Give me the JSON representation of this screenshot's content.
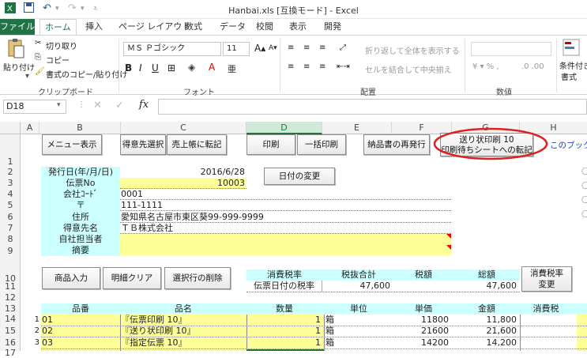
{
  "title_bar": {
    "title": "Hanbai.xls [互換モード] - Excel"
  },
  "tabs": [
    "ファイル",
    "ホーム",
    "挿入",
    "ページ レイアウト",
    "数式",
    "データ",
    "校閲",
    "表示",
    "開発"
  ],
  "ribbon": {
    "clipboard": {
      "paste": "貼り付け",
      "cut": "切り取り",
      "copy": "コピー",
      "format_painter": "書式のコピー/貼り付け",
      "group": "クリップボード"
    },
    "font": {
      "font_name": "ＭＳ Ｐゴシック",
      "font_size": "11",
      "group": "フォント"
    },
    "alignment": {
      "wrap": "折り返して全体を表示する",
      "merge": "セルを結合して中央揃え",
      "group": "配置"
    },
    "number": {
      "group": "数値"
    },
    "styles": {
      "cond": "条件付き",
      "fmt": "書式"
    }
  },
  "formula_bar": {
    "name_box": "D18",
    "fx": "fx"
  },
  "columns": [
    "A",
    "B",
    "C",
    "D",
    "E",
    "F",
    "G",
    "H"
  ],
  "rows": [
    "1",
    "2",
    "3",
    "4",
    "5",
    "6",
    "7",
    "8",
    "9",
    "10",
    "11",
    "12",
    "13",
    "14",
    "15",
    "16",
    "17"
  ],
  "buttons": {
    "menu": "メニュー表示",
    "client_select": "得意先選択",
    "to_ledger": "売上帳に転記",
    "print": "印刷",
    "batch_print": "一括印刷",
    "reissue": "納品書の再発行",
    "transfer_line1": "送り状印刷 10",
    "transfer_line2": "印刷待ちシートへの転記",
    "book_link": "このブック",
    "date_change": "日付の変更",
    "product_input": "商品入力",
    "detail_clear": "明細クリア",
    "delete_row": "選択行の削除",
    "tax_change_1": "消費税率",
    "tax_change_2": "変更"
  },
  "header_fields": {
    "issue_date_label": "発行日(年/月/日)",
    "issue_date": "2016/6/28",
    "slip_no_label": "伝票No",
    "slip_no": "10003",
    "company_code_label": "会社ｺｰﾄﾞ",
    "company_code": "0001",
    "zip_label": "〒",
    "zip": "111-1111",
    "address_label": "住所",
    "address": "愛知県名古屋市東区葵99-999-9999",
    "client_label": "得意先名",
    "client": "ＴＢ株式会社",
    "staff_label": "自社担当者",
    "staff": "",
    "memo_label": "摘要",
    "memo": ""
  },
  "summary": {
    "tax_rate_label": "消費税率",
    "pretax_label": "税抜合計",
    "tax_label": "税額",
    "total_label": "総額",
    "tax_rate_value": "伝票日付の税率",
    "pretax_value": "47,600",
    "tax_value": "",
    "total_value": "47,600"
  },
  "table": {
    "headers": [
      "品番",
      "品名",
      "数量",
      "単位",
      "単価",
      "金額",
      "消費税"
    ],
    "rows": [
      {
        "no": "1",
        "code": "01",
        "name": "『伝票印刷 10』",
        "qty": "1",
        "unit": "箱",
        "price": "11800",
        "amount": "11,800"
      },
      {
        "no": "2",
        "code": "02",
        "name": "『送り状印刷 10』",
        "qty": "1",
        "unit": "箱",
        "price": "21600",
        "amount": "21,600"
      },
      {
        "no": "3",
        "code": "03",
        "name": "『指定伝票 10』",
        "qty": "1",
        "unit": "箱",
        "price": "14200",
        "amount": "14,200"
      }
    ]
  },
  "colors": {
    "excel_green": "#217346",
    "yellow": "#ffff99",
    "cyan": "#ccffff",
    "highlight": "#e02020"
  }
}
